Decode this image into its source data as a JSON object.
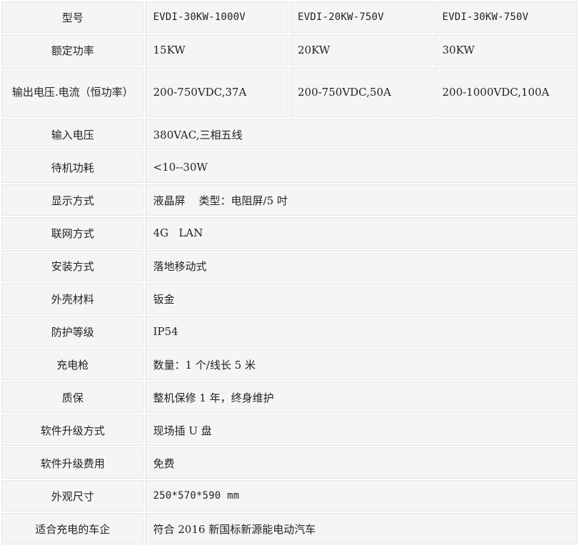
{
  "table": {
    "header": {
      "label": "型号",
      "models": [
        "EVDI-30KW-1000V",
        "EVDI-20KW-750V",
        "EVDI-30KW-750V"
      ]
    },
    "rated_power": {
      "label": "额定功率",
      "values": [
        "15KW",
        "20KW",
        "30KW"
      ]
    },
    "output": {
      "label": "输出电压.电流（恒功率）",
      "values": [
        "200-750VDC,37A",
        "200-750VDC,50A",
        "200-1000VDC,100A"
      ]
    },
    "rows": [
      {
        "label": "输入电压",
        "value": "380VAC,三相五线"
      },
      {
        "label": "待机功耗",
        "value": "<10--30W"
      },
      {
        "label": "显示方式",
        "value": "液晶屏    类型：电阻屏/5 吋"
      },
      {
        "label": "联网方式",
        "value": "4G   LAN"
      },
      {
        "label": "安装方式",
        "value": "落地移动式"
      },
      {
        "label": "外壳材料",
        "value": "钣金"
      },
      {
        "label": "防护等级",
        "value": "IP54"
      },
      {
        "label": "充电枪",
        "value": "数量：1 个/线长 5 米"
      },
      {
        "label": "质保",
        "value": "整机保修 1 年，终身维护"
      },
      {
        "label": "软件升级方式",
        "value": "现场插 U 盘"
      },
      {
        "label": "软件升级费用",
        "value": "免费"
      },
      {
        "label": "外观尺寸",
        "value": "250*570*590 mm"
      },
      {
        "label": "适合充电的车企",
        "value": "符合 2016 新国标新源能电动汽车"
      }
    ]
  }
}
